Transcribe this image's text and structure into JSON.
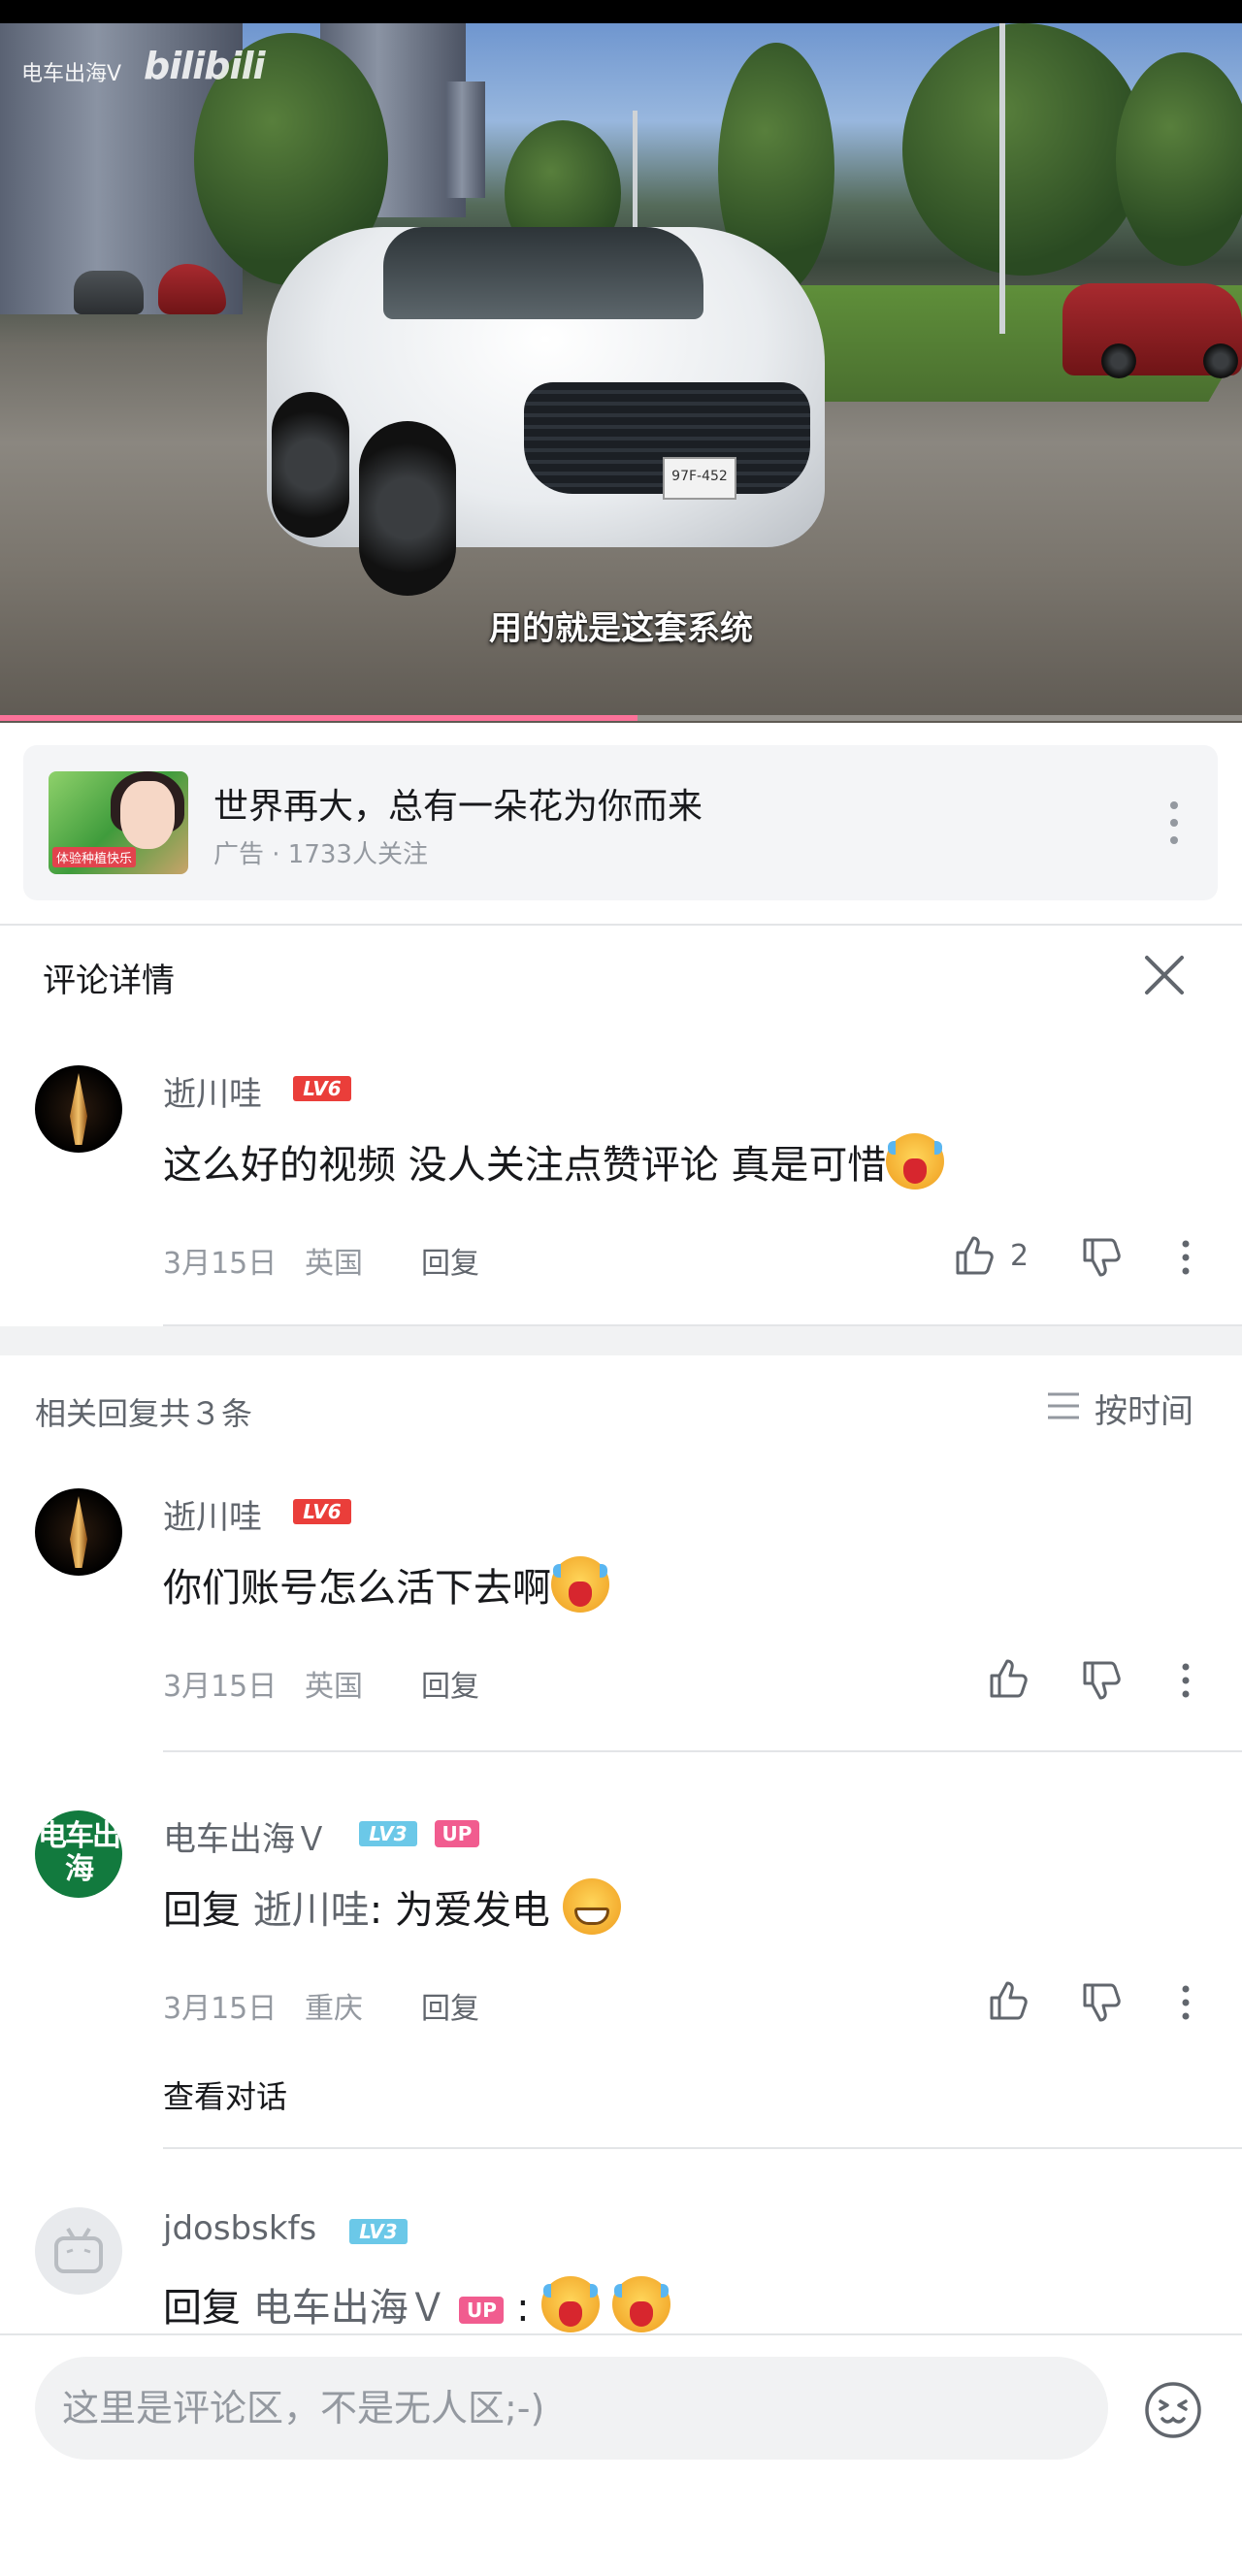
{
  "video": {
    "watermark": "电车出海V",
    "platform_logo": "bilibili",
    "subtitle": "用的就是这套系统",
    "license_plate": "97F-452",
    "progress_fraction": 0.513,
    "progress_color": "#fb7299"
  },
  "ad": {
    "thumb_tag": "体验种植快乐",
    "title": "世界再大，总有一朵花为你而来",
    "meta": "广告 · 1733人关注",
    "more_icon": "more-vertical-icon"
  },
  "detail": {
    "title": "评论详情",
    "close_icon": "close-icon"
  },
  "main_comment": {
    "user": "逝川哇",
    "level": "LV6",
    "text": "这么好的视频 没人关注点赞评论 真是可惜",
    "emoji": "cry-emoji",
    "date": "3月15日",
    "location": "英国",
    "reply_label": "回复",
    "likes": "2"
  },
  "replies_header": {
    "count_text": "相关回复共３条",
    "sort_label": "按时间",
    "sort_icon": "list-sort-icon"
  },
  "replies": [
    {
      "user": "逝川哇",
      "level": "LV6",
      "text": "你们账号怎么活下去啊",
      "emoji": "cry-emoji",
      "date": "3月15日",
      "location": "英国",
      "reply_label": "回复"
    },
    {
      "user": "电车出海Ｖ",
      "avatar_text": "电车出海",
      "level": "LV3",
      "up_badge": "UP",
      "reply_prefix": "回复",
      "mention": "逝川哇",
      "text": ": 为爱发电",
      "emoji": "grin-emoji",
      "date": "3月15日",
      "location": "重庆",
      "reply_label": "回复",
      "view_conversation": "查看对话"
    },
    {
      "user": "jdosbskfs",
      "level": "LV3",
      "reply_prefix": "回复",
      "mention": "电车出海Ｖ",
      "up_badge": "UP",
      "text": ":",
      "emoji": "cry-emoji"
    }
  ],
  "input": {
    "placeholder": "这里是评论区，不是无人区;-)",
    "emoji_icon": "emoji-face-icon"
  },
  "colors": {
    "accent_pink": "#fb7299",
    "level6_red": "#ea3e3a",
    "level3_blue": "#6bc8e8",
    "up_pink": "#f15c8f",
    "text_gray": "#9499a0"
  }
}
